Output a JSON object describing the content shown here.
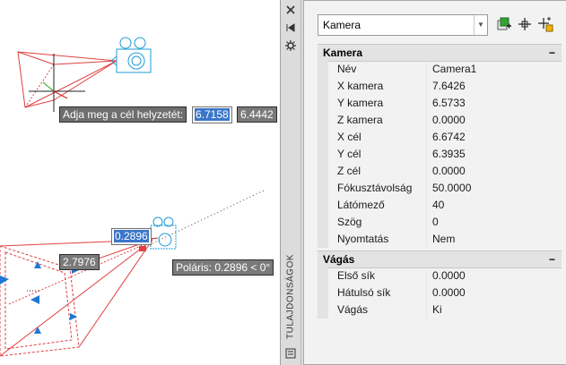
{
  "prompt": {
    "label": "Adja meg a cél helyzetét:",
    "x_value": "6.7158",
    "y_value": "6.4442"
  },
  "dimension_inputs": {
    "lens_value": "0.2896",
    "distance_value": "2.7976",
    "polar_tooltip": "Poláris: 0.2896 < 0°"
  },
  "palette": {
    "title": "TULAJDONSÁGOK",
    "object_select": "Kamera",
    "sections": [
      {
        "title": "Kamera",
        "rows": [
          {
            "name": "Név",
            "value": "Camera1"
          },
          {
            "name": "X kamera",
            "value": "7.6426"
          },
          {
            "name": "Y kamera",
            "value": "6.5733"
          },
          {
            "name": "Z kamera",
            "value": "0.0000"
          },
          {
            "name": "X cél",
            "value": "6.6742"
          },
          {
            "name": "Y cél",
            "value": "6.3935"
          },
          {
            "name": "Z cél",
            "value": "0.0000"
          },
          {
            "name": "Fókusztávolság",
            "value": "50.0000"
          },
          {
            "name": "Látómező",
            "value": "40"
          },
          {
            "name": "Szög",
            "value": "0"
          },
          {
            "name": "Nyomtatás",
            "value": "Nem"
          }
        ]
      },
      {
        "title": "Vágás",
        "rows": [
          {
            "name": "Első sík",
            "value": "0.0000"
          },
          {
            "name": "Hátulsó sík",
            "value": "0.0000"
          },
          {
            "name": "Vágás",
            "value": "Ki"
          }
        ]
      }
    ]
  },
  "icons": [
    "close-icon",
    "autohide-icon",
    "options-icon",
    "object-select-dropdown-icon",
    "quick-select-icon",
    "select-objects-icon",
    "pickadd-icon",
    "palette-menu-icon"
  ],
  "colors": {
    "frustum": "#e04040",
    "camera_glyph": "#1f9bd7",
    "grip": "#1e78d2",
    "selection": "#3a76c9"
  }
}
